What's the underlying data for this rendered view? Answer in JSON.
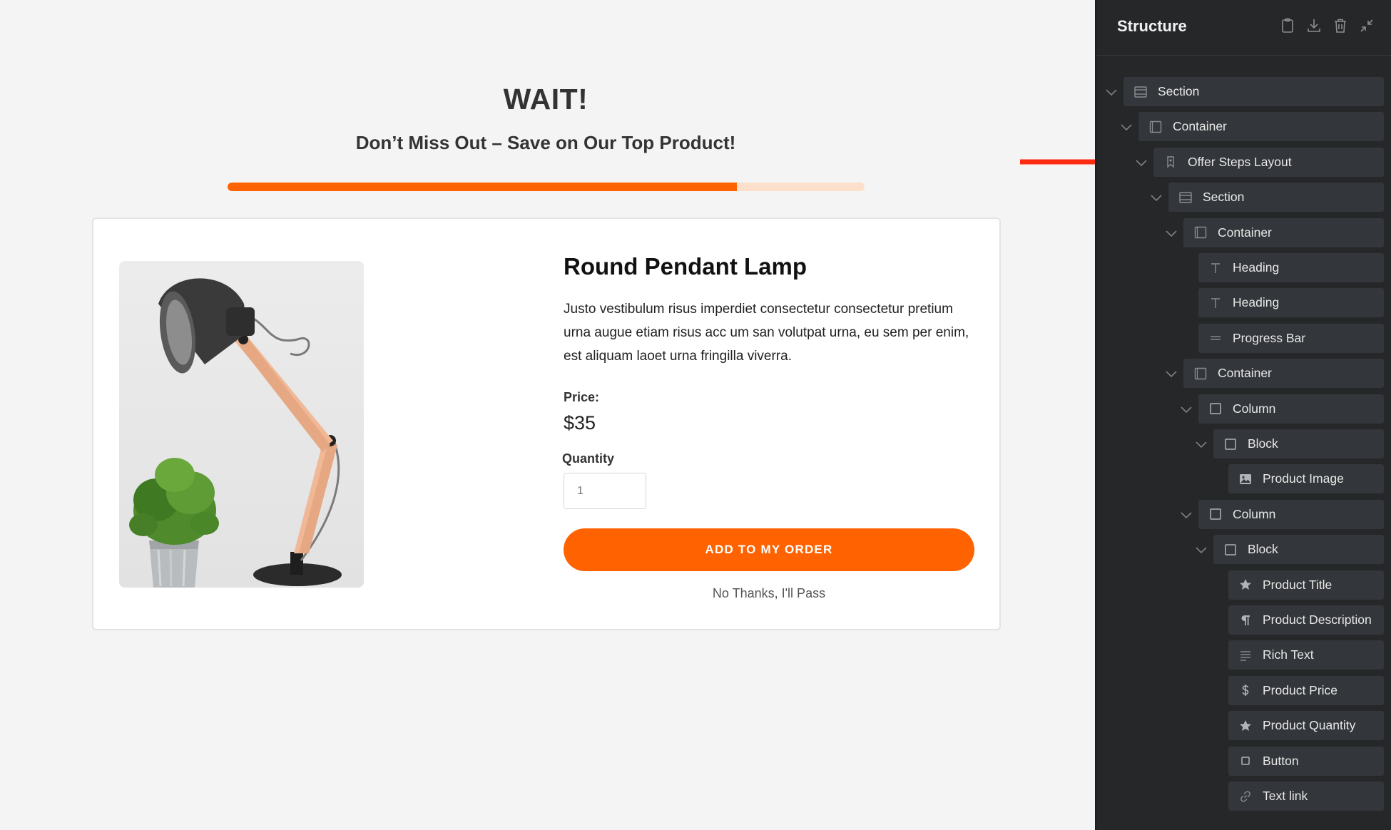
{
  "upsell": {
    "heading": "WAIT!",
    "subheading": "Don’t Miss Out – Save on Our Top Product!",
    "progress_fraction": 0.8,
    "accent_color": "#ff6200"
  },
  "product": {
    "image_description": "desk-lamp-and-plant",
    "title": "Round Pendant Lamp",
    "description": "Justo vestibulum risus imperdiet consectetur consectetur pretium urna augue etiam risus acc um san volutpat urna, eu sem per enim, est aliquam laoet urna fringilla viverra.",
    "price_label": "Price:",
    "price": "$35",
    "quantity_label": "Quantity",
    "quantity_value": "1",
    "add_button": "ADD TO MY ORDER",
    "decline_link": "No Thanks, I'll Pass"
  },
  "structure_panel": {
    "title": "Structure",
    "header_icons": [
      "clipboard-icon",
      "download-icon",
      "trash-icon",
      "collapse-icon"
    ],
    "items": [
      {
        "label": "Section",
        "icon": "section-icon",
        "expanded": true
      },
      {
        "label": "Container",
        "icon": "container-icon",
        "expanded": true
      },
      {
        "label": "Offer Steps Layout",
        "icon": "bookmark-icon",
        "expanded": true
      },
      {
        "label": "Section",
        "icon": "section-icon",
        "expanded": true
      },
      {
        "label": "Container",
        "icon": "container-icon",
        "expanded": true
      },
      {
        "label": "Heading",
        "icon": "heading-icon"
      },
      {
        "label": "Heading",
        "icon": "heading-icon"
      },
      {
        "label": "Progress Bar",
        "icon": "progress-bar-icon"
      },
      {
        "label": "Container",
        "icon": "container-icon",
        "expanded": true
      },
      {
        "label": "Column",
        "icon": "column-icon",
        "expanded": true
      },
      {
        "label": "Block",
        "icon": "block-icon",
        "expanded": true
      },
      {
        "label": "Product Image",
        "icon": "image-icon"
      },
      {
        "label": "Column",
        "icon": "column-icon",
        "expanded": true
      },
      {
        "label": "Block",
        "icon": "block-icon",
        "expanded": true
      },
      {
        "label": "Product Title",
        "icon": "star-icon"
      },
      {
        "label": "Product Description",
        "icon": "paragraph-icon"
      },
      {
        "label": "Rich Text",
        "icon": "rich-text-icon"
      },
      {
        "label": "Product Price",
        "icon": "dollar-icon"
      },
      {
        "label": "Product Quantity",
        "icon": "star-icon"
      },
      {
        "label": "Button",
        "icon": "button-icon"
      },
      {
        "label": "Text link",
        "icon": "link-icon"
      }
    ]
  },
  "annotations": {
    "arrow_color": "#ff2a12",
    "highlighted_items": [
      "Offer Steps Layout",
      "Product Image",
      "Product Title",
      "Product Description",
      "Product Price",
      "Product Quantity"
    ]
  }
}
